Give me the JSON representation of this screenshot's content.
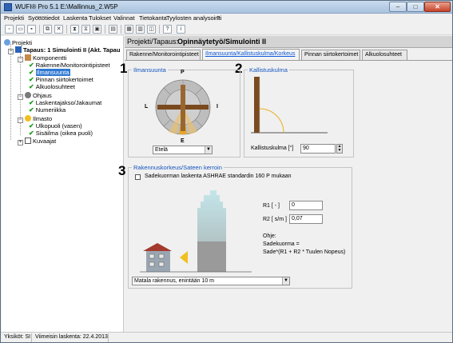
{
  "window": {
    "title": "WUFI® Pro 5.1     E:\\Mallinnus_2.W5P"
  },
  "titlebar_buttons": {
    "min": "–",
    "max": "□",
    "close": "✕"
  },
  "menu": [
    "Projekti",
    "Syöttötiedot",
    "Laskenta",
    "Tulokset",
    "Valinnat",
    "Tietokanta",
    "Tyylosten analysointi",
    "?"
  ],
  "tree": {
    "root": "Projekti",
    "case": "Tapaus: 1 Simulointi II (Akt. Tapau",
    "groups": {
      "components": {
        "label": "Komponentti",
        "items": [
          "Rakenne/Monitorointipisteet",
          "Ilmansuunta",
          "Pinnan siirtokertoimet",
          "Alkuolosuhteet"
        ]
      },
      "control": {
        "label": "Ohjaus",
        "items": [
          "Laskentajakso/Jakaumat",
          "Numeriikka"
        ]
      },
      "climate": {
        "label": "Ilmasto",
        "items": [
          "Ulkopuoli (vasen)",
          "Sisäilma (oikea puoli)"
        ]
      },
      "graphs": {
        "label": "Kuvaajat"
      }
    },
    "selected": "Ilmansuunta"
  },
  "header": {
    "path_label": "Projekti/Tapaus:",
    "path_value": "Opinnäytetyö/Simulointi II"
  },
  "tabs": [
    {
      "label": "Rakenne/Monitorointipisteet",
      "active": false
    },
    {
      "label": "Ilmansuunta/Kallistuskulma/Korkeus",
      "active": true
    },
    {
      "label": "Pinnan siirtokertoimet",
      "active": false
    },
    {
      "label": "Alkuolosuhteet",
      "active": false
    }
  ],
  "markers": [
    "1",
    "2",
    "3"
  ],
  "orientation": {
    "title": "Ilmansuunta",
    "compass": {
      "n": "P",
      "e": "I",
      "s": "E",
      "w": "L"
    },
    "selected": "Etelä"
  },
  "inclination": {
    "title": "Kallistuskulma",
    "label": "Kallistuskulma [°]",
    "value": "90"
  },
  "height": {
    "title": "Rakennuskorkeus/Sateen kerroin",
    "checkbox_label": "Sadekuorman laskenta ASHRAE standardin 160 P mukaan",
    "checkbox_checked": false,
    "r1_label": "R1 [ - ]",
    "r1_value": "0",
    "r2_label": "R2 [ s/m ]",
    "r2_value": "0,07",
    "help_title": "Ohje:",
    "help_line1": "Sadekuorma =",
    "help_line2": "Sade*(R1 + R2 * Tuulen Nopeus)",
    "building_select": "Matala rakennus, enintään 10 m"
  },
  "status": {
    "units": "Yksiköt: SI",
    "last_calc": "Viimeisin laskenta: 22.4.2013"
  },
  "colors": {
    "accent": "#1455bf",
    "selection": "#3179d1",
    "check": "#1a9a1a",
    "wall": "#8b5a2b"
  }
}
